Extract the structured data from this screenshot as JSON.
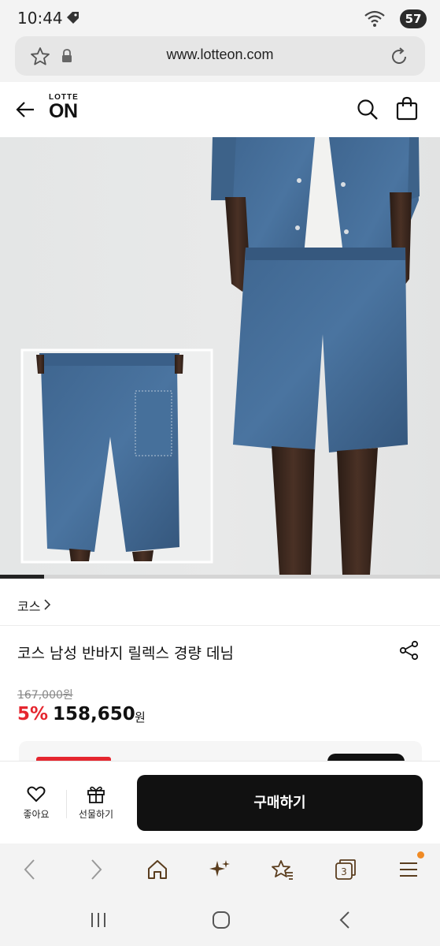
{
  "status_bar": {
    "time": "10:44",
    "battery": "57"
  },
  "url_bar": {
    "url": "www.lotteon.com"
  },
  "header": {
    "logo_small": "LOTTE",
    "logo_big": "ON"
  },
  "gallery": {
    "progress": 0.1,
    "total_label": ""
  },
  "product": {
    "brand": "코스",
    "title": "코스 남성 반바지 릴렉스 경량 데님",
    "original_price": "167,000원",
    "discount_rate": "5%",
    "sale_price": "158,650",
    "currency": "원"
  },
  "action_bar": {
    "like_label": "좋아요",
    "gift_label": "선물하기",
    "buy_label": "구매하기"
  },
  "browser_toolbar": {
    "tabs_count": "3",
    "accent": "#f08a24"
  },
  "colors": {
    "discount": "#e5262f",
    "buy_button": "#111111"
  },
  "icons": [
    "tag-icon",
    "wifi-icon",
    "star-icon",
    "lock-icon",
    "reload-icon",
    "back-arrow-icon",
    "search-icon",
    "shopping-bag-icon",
    "chevron-right-icon",
    "share-icon",
    "heart-icon",
    "gift-icon",
    "home-icon",
    "sparkle-icon",
    "bookmarks-icon",
    "tabs-icon",
    "menu-icon",
    "recents-icon",
    "home-circle-icon",
    "back-icon"
  ]
}
